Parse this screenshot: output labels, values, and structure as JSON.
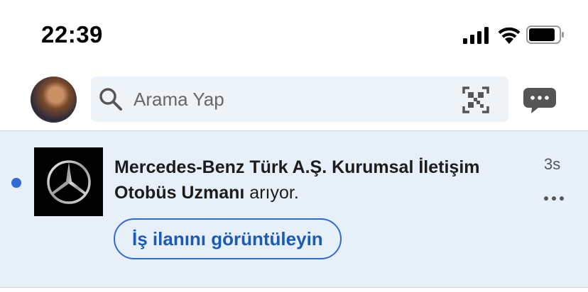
{
  "status_bar": {
    "time": "22:39",
    "icons": [
      "cellular-signal-icon",
      "wifi-icon",
      "battery-icon"
    ]
  },
  "header": {
    "search_placeholder": "Arama Yap",
    "icons": [
      "avatar",
      "search-icon",
      "qr-code-icon",
      "messaging-icon"
    ]
  },
  "notification": {
    "company_bold": "Mercedes-Benz Türk A.Ş. Kurumsal İletişim Otobüs Uzmanı",
    "suffix": " arıyor.",
    "timestamp": "3s",
    "button_label": "İş ilanını görüntüleyin",
    "unread": true,
    "accent_color": "#2f6ad6",
    "background_color": "#e7eff9"
  }
}
